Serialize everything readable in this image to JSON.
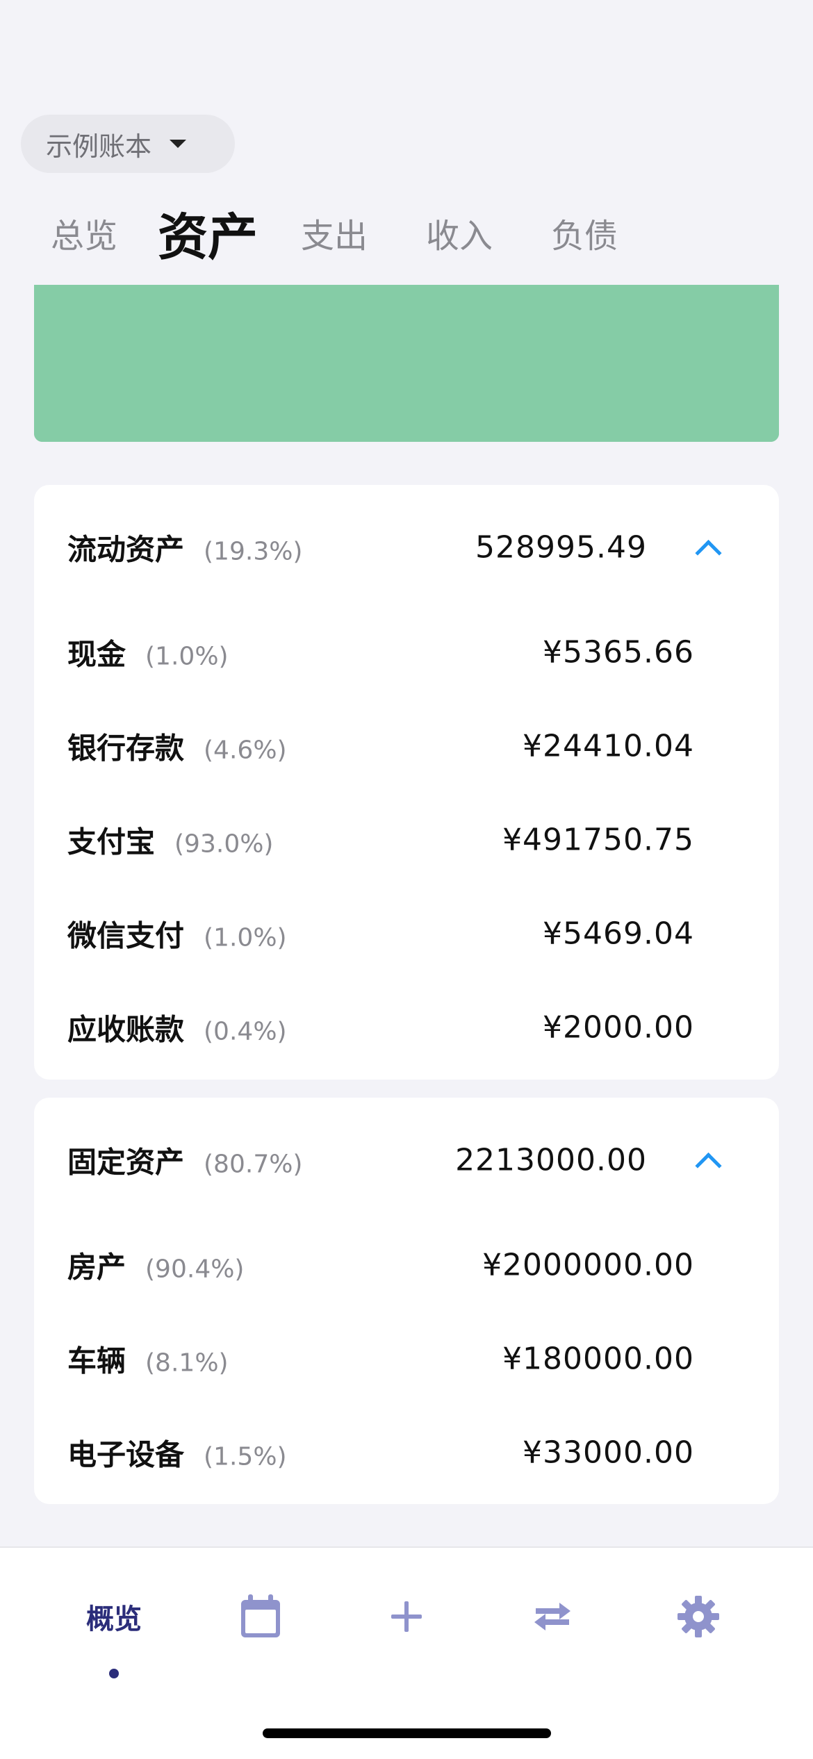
{
  "book_selector": {
    "label": "示例账本"
  },
  "tabs": [
    {
      "label": "总览",
      "active": false
    },
    {
      "label": "资产",
      "active": true
    },
    {
      "label": "支出",
      "active": false
    },
    {
      "label": "收入",
      "active": false
    },
    {
      "label": "负债",
      "active": false
    }
  ],
  "treemap": {
    "color": "#85cca6"
  },
  "groups": [
    {
      "name": "流动资产",
      "pct": "(19.3%)",
      "total": "528995.49",
      "items": [
        {
          "name": "现金",
          "pct": "(1.0%)",
          "amount": "¥5365.66"
        },
        {
          "name": "银行存款",
          "pct": "(4.6%)",
          "amount": "¥24410.04"
        },
        {
          "name": "支付宝",
          "pct": "(93.0%)",
          "amount": "¥491750.75"
        },
        {
          "name": "微信支付",
          "pct": "(1.0%)",
          "amount": "¥5469.04"
        },
        {
          "name": "应收账款",
          "pct": "(0.4%)",
          "amount": "¥2000.00"
        }
      ]
    },
    {
      "name": "固定资产",
      "pct": "(80.7%)",
      "total": "2213000.00",
      "items": [
        {
          "name": "房产",
          "pct": "(90.4%)",
          "amount": "¥2000000.00"
        },
        {
          "name": "车辆",
          "pct": "(8.1%)",
          "amount": "¥180000.00"
        },
        {
          "name": "电子设备",
          "pct": "(1.5%)",
          "amount": "¥33000.00"
        }
      ]
    }
  ],
  "bottom_nav": {
    "overview_label": "概览",
    "icons": [
      "calendar-icon",
      "plus-icon",
      "transfer-icon",
      "gear-icon"
    ],
    "active_color": "#2b2d7a",
    "icon_color": "#8f93cc"
  },
  "accent_color": "#2196f3"
}
